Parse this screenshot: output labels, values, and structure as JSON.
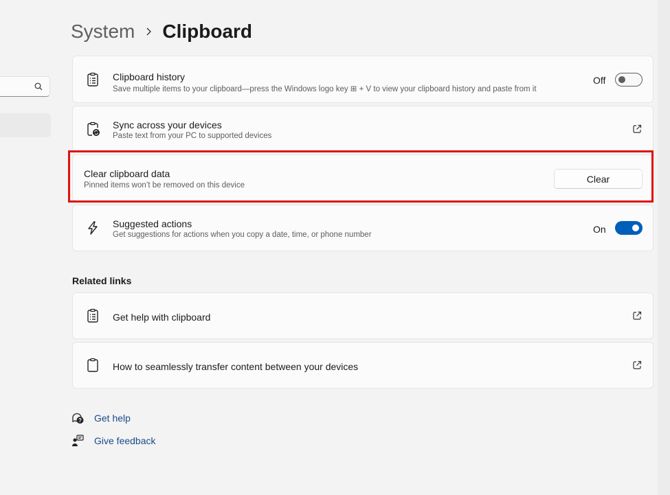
{
  "breadcrumb": {
    "parent": "System",
    "current": "Clipboard"
  },
  "settings": {
    "history": {
      "title": "Clipboard history",
      "description": "Save multiple items to your clipboard—press the Windows logo key ⊞ + V to view your clipboard history and paste from it",
      "toggle_label": "Off",
      "toggle_state": "off"
    },
    "sync": {
      "title": "Sync across your devices",
      "description": "Paste text from your PC to supported devices"
    },
    "clear": {
      "title": "Clear clipboard data",
      "description": "Pinned items won’t be removed on this device",
      "button_label": "Clear"
    },
    "suggested": {
      "title": "Suggested actions",
      "description": "Get suggestions for actions when you copy a date, time, or phone number",
      "toggle_label": "On",
      "toggle_state": "on"
    }
  },
  "related": {
    "heading": "Related links",
    "links": [
      {
        "label": "Get help with clipboard"
      },
      {
        "label": "How to seamlessly transfer content between your devices"
      }
    ]
  },
  "footer": {
    "get_help": "Get help",
    "give_feedback": "Give feedback"
  },
  "colors": {
    "accent": "#005fb8",
    "highlight_border": "#e01010",
    "link": "#1a4a8a"
  },
  "icons": {
    "search": "search-icon",
    "history": "clipboard-list-icon",
    "sync": "clipboard-sync-icon",
    "suggested": "lightning-icon",
    "external": "open-external-icon",
    "help": "help-chat-icon",
    "feedback": "feedback-icon"
  }
}
